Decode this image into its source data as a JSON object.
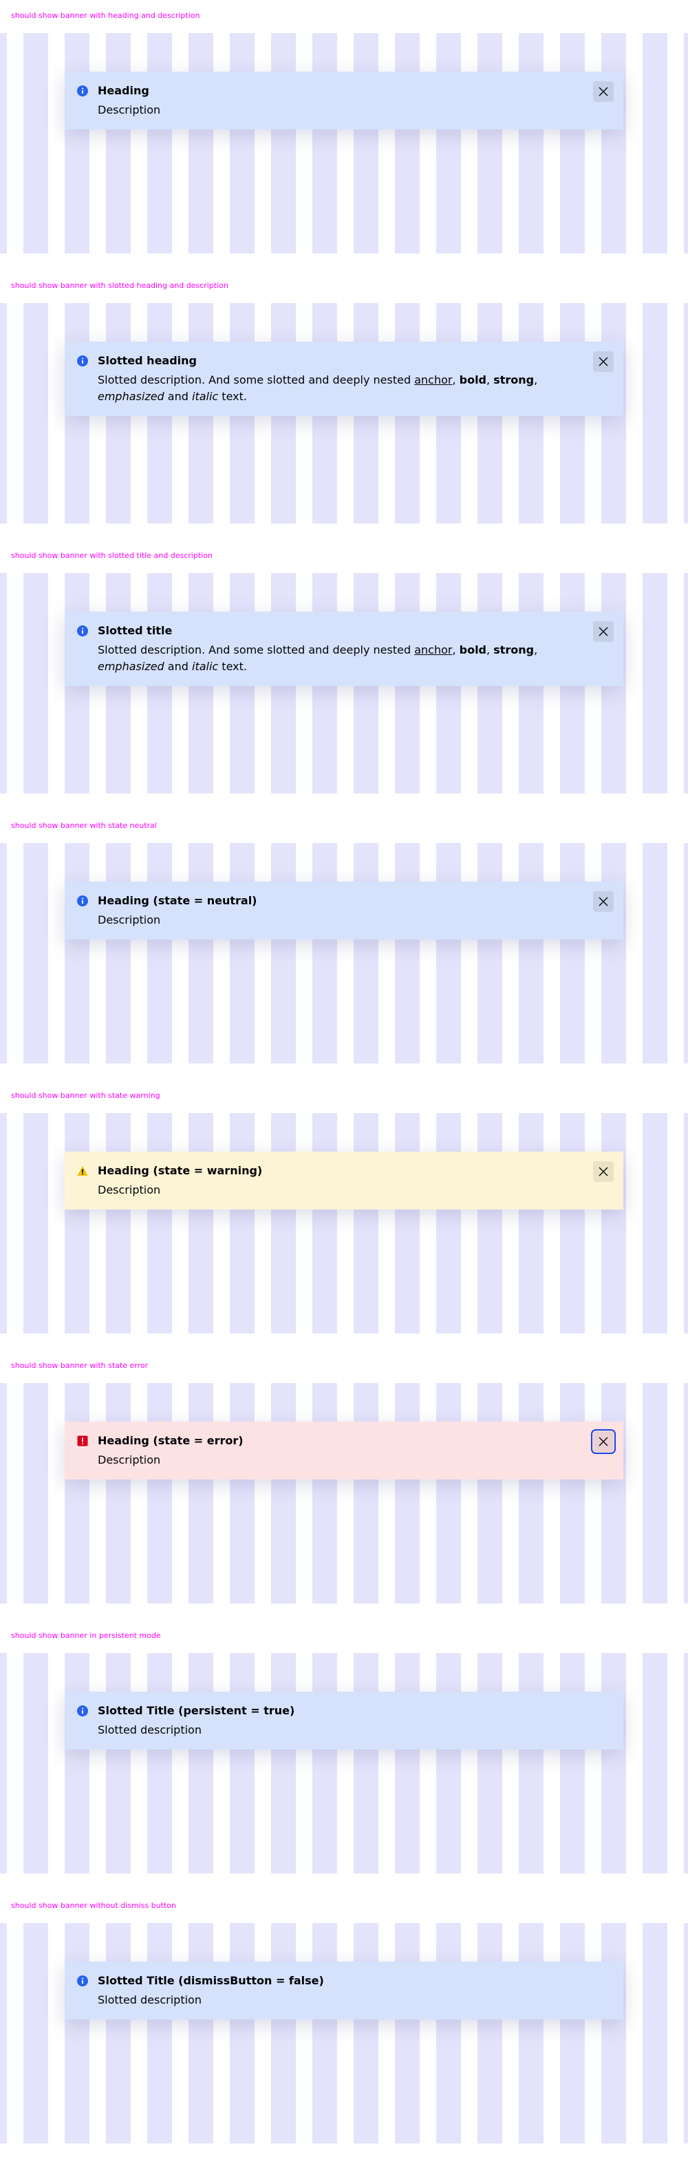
{
  "sections": [
    {
      "label": "should show banner with heading and description",
      "state": "info",
      "heading": "Heading",
      "description": "Description",
      "dismiss": true
    },
    {
      "label": "should show banner with slotted heading and description",
      "state": "info",
      "heading": "Slotted heading",
      "rich_description": {
        "pre": "Slotted description. And some slotted and deeply nested ",
        "link": "anchor",
        "sep1": ", ",
        "bold": "bold",
        "sep2": ", ",
        "strong": "strong",
        "sep3": ", ",
        "em": "emphasized",
        "sep4": " and ",
        "italic": "italic",
        "post": " text."
      },
      "dismiss": true
    },
    {
      "label": "should show banner with slotted title and description",
      "state": "info",
      "heading": "Slotted title",
      "rich_description": {
        "pre": "Slotted description. And some slotted and deeply nested ",
        "link": "anchor",
        "sep1": ", ",
        "bold": "bold",
        "sep2": ", ",
        "strong": "strong",
        "sep3": ", ",
        "em": "emphasized",
        "sep4": " and ",
        "italic": "italic",
        "post": " text."
      },
      "dismiss": true
    },
    {
      "label": "should show banner with state neutral",
      "state": "neutral",
      "heading": "Heading (state = neutral)",
      "description": "Description",
      "dismiss": true
    },
    {
      "label": "should show banner with state warning",
      "state": "warning",
      "heading": "Heading (state = warning)",
      "description": "Description",
      "dismiss": true
    },
    {
      "label": "should show banner with state error",
      "state": "error",
      "heading": "Heading (state = error)",
      "description": "Description",
      "dismiss": true,
      "dismiss_focused": true
    },
    {
      "label": "should show banner in persistent mode",
      "state": "info",
      "heading": "Slotted Title (persistent = true)",
      "description": "Slotted description",
      "dismiss": false
    },
    {
      "label": "should show banner without dismiss button",
      "state": "info",
      "heading": "Slotted Title (dismissButton = false)",
      "description": "Slotted description",
      "dismiss": false
    }
  ],
  "icons": {
    "info": "information-icon",
    "neutral": "information-icon",
    "warning": "warning-icon",
    "error": "error-icon",
    "close": "close-icon"
  },
  "colors": {
    "label": "#ff00ff",
    "grid_stripe": "#e3e3fb",
    "info_bg": "#d6e2fc",
    "warning_bg": "#fdf4d6",
    "error_bg": "#fde2e4",
    "info_icon": "#2762ec",
    "warning_icon": "#f2c00a",
    "error_icon": "#d5001c",
    "focus": "#1a44ea"
  }
}
